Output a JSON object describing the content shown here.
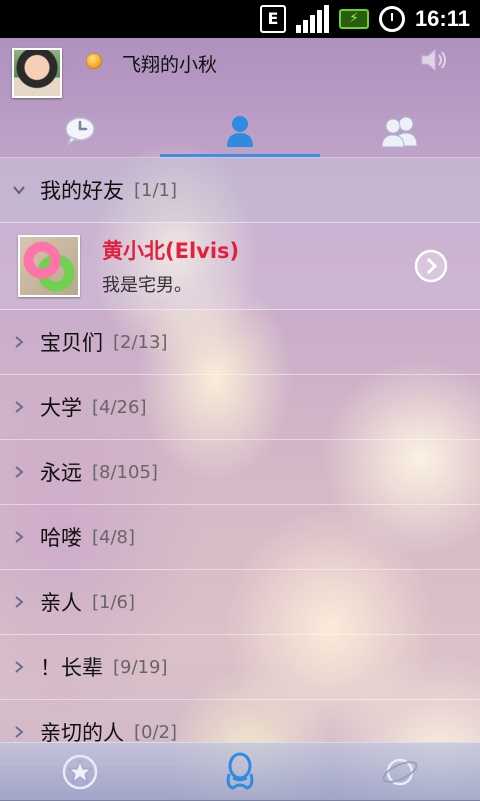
{
  "status_bar": {
    "network_label": "E",
    "time": "16:11",
    "battery_color": "#6bd12b"
  },
  "header": {
    "username": "飞翔的小秋"
  },
  "tabs": [
    {
      "name": "recent-chats",
      "icon": "clock-icon",
      "active": false
    },
    {
      "name": "friends",
      "icon": "person-icon",
      "active": true
    },
    {
      "name": "groups",
      "icon": "people-icon",
      "active": false
    }
  ],
  "groups": [
    {
      "name": "我的好友",
      "count": "[1/1]",
      "expanded": true,
      "friends": [
        {
          "name": "黄小北(Elvis)",
          "signature": "我是宅男。"
        }
      ]
    },
    {
      "name": "宝贝们",
      "count": "[2/13]"
    },
    {
      "name": "大学",
      "count": "[4/26]"
    },
    {
      "name": "永远",
      "count": "[8/105]"
    },
    {
      "name": "哈喽",
      "count": "[4/8]"
    },
    {
      "name": "亲人",
      "count": "[1/6]"
    },
    {
      "name": "！长辈",
      "count": "[9/19]"
    },
    {
      "name": "亲切的人",
      "count": "[0/2]"
    }
  ],
  "colors": {
    "accent": "#3e8fe0",
    "online_name": "#e2203e"
  },
  "bottom_nav": [
    {
      "icon": "star-icon"
    },
    {
      "icon": "qq-penguin-icon",
      "active": true
    },
    {
      "icon": "planet-icon"
    }
  ]
}
